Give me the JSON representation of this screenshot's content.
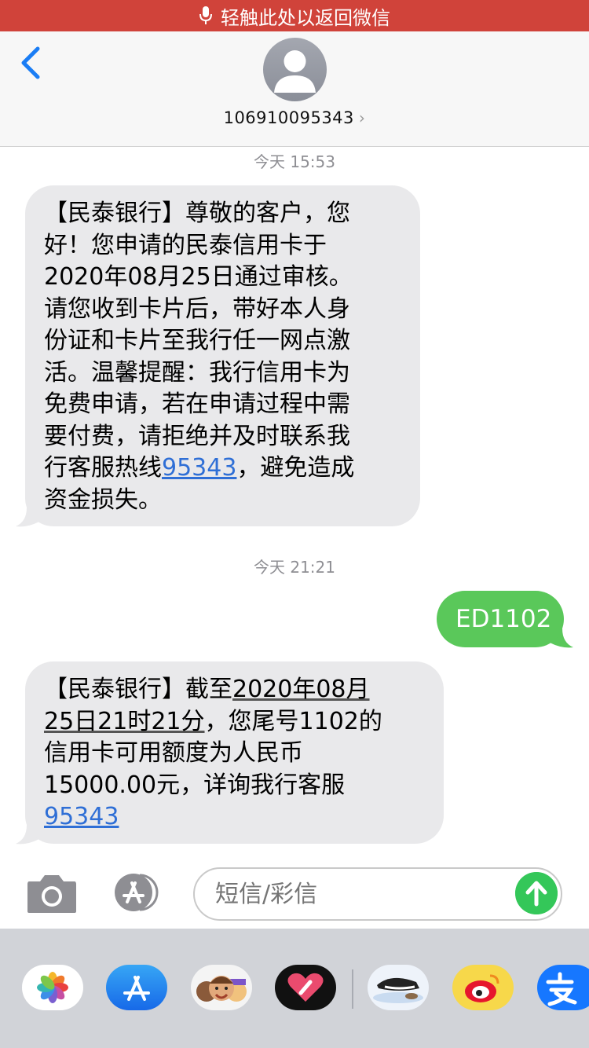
{
  "status_bar": {
    "text": "轻触此处以返回微信"
  },
  "header": {
    "contact": "106910095343"
  },
  "messages": [
    {
      "type": "timestamp",
      "text": "今天 15:53"
    },
    {
      "type": "incoming",
      "lines": [
        "【民泰银行】尊敬的客户，您",
        "好！您申请的民泰信用卡于",
        "2020年08月25日通过审核。",
        "请您收到卡片后，带好本人身",
        "份证和卡片至我行任一网点激",
        "活。温馨提醒：我行信用卡为",
        "免费申请，若在申请过程中需",
        "要付费，请拒绝并及时联系我"
      ],
      "line9_before": "行客服热线",
      "line9_link": "95343",
      "line9_after": "，避免造成",
      "line10": "资金损失。"
    },
    {
      "type": "timestamp",
      "text": "今天 21:21"
    },
    {
      "type": "outgoing",
      "text": "ED1102"
    },
    {
      "type": "incoming",
      "line1_prefix": "【民泰银行】截至",
      "line1_date": "2020年08月",
      "line2_date": "25日21时21分",
      "line2_suffix": "，您尾号1102的",
      "line3": "信用卡可用额度为人民币",
      "line4": "15000.00元，详询我行客服",
      "link": "95343"
    }
  ],
  "composer": {
    "placeholder": "短信/彩信"
  },
  "app_tray": {
    "apps": [
      "photos-icon",
      "app-store-icon",
      "memoji-icon",
      "digital-touch-icon",
      "penguin-sticker-icon",
      "weibo-icon",
      "alipay-icon"
    ]
  },
  "colors": {
    "status_bar": "#d0433a",
    "incoming_bubble": "#e9e9eb",
    "outgoing_bubble": "#5ac85a",
    "link": "#2f6fd6",
    "send_button": "#34c759",
    "back_accent": "#1a7df5"
  }
}
